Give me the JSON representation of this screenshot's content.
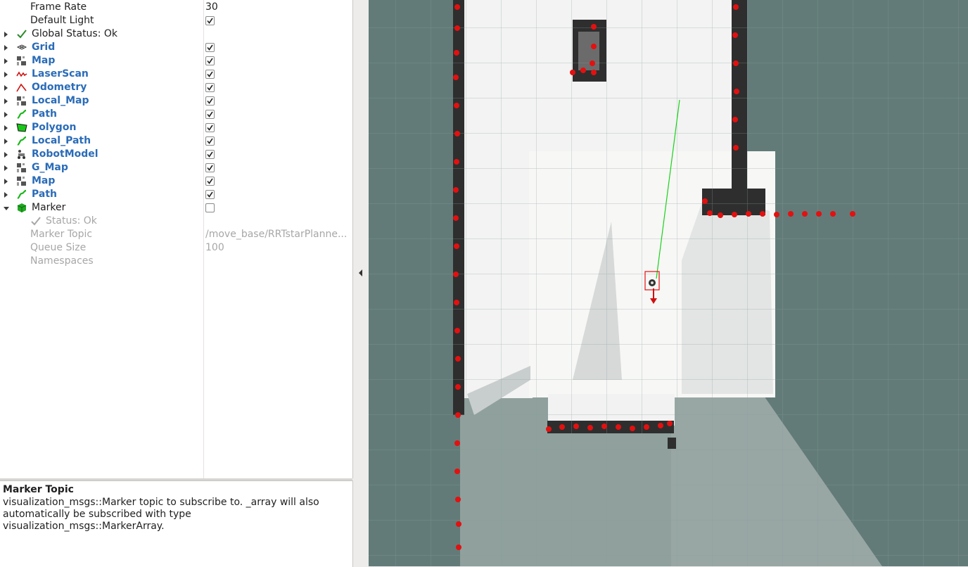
{
  "properties": {
    "frame_rate": {
      "label": "Frame Rate",
      "value": "30"
    },
    "default_light": {
      "label": "Default Light",
      "checked": true
    },
    "global_status": {
      "label": "Global Status: Ok"
    }
  },
  "displays": [
    {
      "label": "Grid",
      "icon": "grid-icon",
      "checked": true
    },
    {
      "label": "Map",
      "icon": "map-icon",
      "checked": true
    },
    {
      "label": "LaserScan",
      "icon": "laserscan-icon",
      "checked": true
    },
    {
      "label": "Odometry",
      "icon": "odometry-icon",
      "checked": true
    },
    {
      "label": "Local_Map",
      "icon": "map-icon",
      "checked": true
    },
    {
      "label": "Path",
      "icon": "path-icon",
      "checked": true
    },
    {
      "label": "Polygon",
      "icon": "polygon-icon",
      "checked": true
    },
    {
      "label": "Local_Path",
      "icon": "path-icon",
      "checked": true
    },
    {
      "label": "RobotModel",
      "icon": "robot-model-icon",
      "checked": true
    },
    {
      "label": "G_Map",
      "icon": "map-icon",
      "checked": true
    },
    {
      "label": "Map",
      "icon": "map-icon",
      "checked": true
    },
    {
      "label": "Path",
      "icon": "path-icon",
      "checked": true
    }
  ],
  "marker": {
    "label": "Marker",
    "icon": "marker-cube-icon",
    "checked": false,
    "status": "Status: Ok",
    "topic_label": "Marker Topic",
    "topic_value": "/move_base/RRTstarPlanne...",
    "queue_label": "Queue Size",
    "queue_value": "100",
    "namespaces_label": "Namespaces"
  },
  "help": {
    "title": "Marker Topic",
    "body_line1": "visualization_msgs::Marker topic to subscribe to. _array will also",
    "body_line2": "automatically be subscribed with type visualization_msgs::MarkerArray."
  },
  "colors": {
    "display_label": "#2a6cb8",
    "background_grid": "#627b78",
    "laser_points": "#e41010",
    "path": "#19d219",
    "obstacle": "#222222"
  }
}
